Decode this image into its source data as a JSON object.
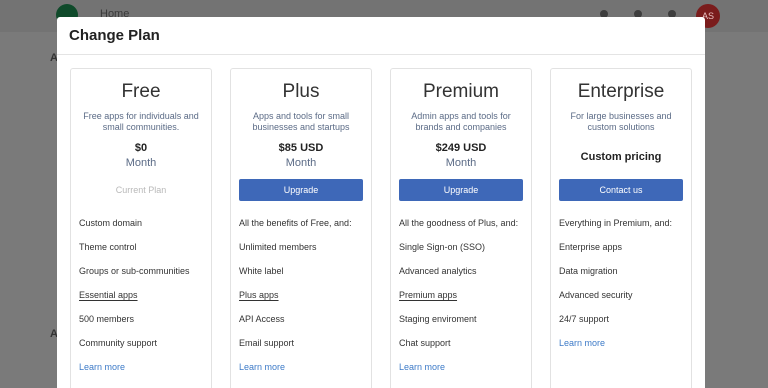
{
  "background": {
    "home_label": "Home",
    "avatar_initials": "AS",
    "letter_a": "A"
  },
  "modal": {
    "title": "Change Plan"
  },
  "plans": [
    {
      "name": "Free",
      "description": "Free apps for individuals and small communities.",
      "price": "$0",
      "period": "Month",
      "action": "Current Plan",
      "features": [
        "Custom domain",
        "Theme control",
        "Groups or sub-communities",
        "Essential apps",
        "500 members",
        "Community support"
      ],
      "learn_more": "Learn more"
    },
    {
      "name": "Plus",
      "description": "Apps and tools for small businesses and startups",
      "price": "$85 USD",
      "period": "Month",
      "action": "Upgrade",
      "features": [
        "All the benefits of Free, and:",
        "Unlimited members",
        "White label",
        "Plus apps",
        "API Access",
        "Email support"
      ],
      "learn_more": "Learn more"
    },
    {
      "name": "Premium",
      "description": "Admin apps and tools for brands and companies",
      "price": "$249 USD",
      "period": "Month",
      "action": "Upgrade",
      "features": [
        "All the goodness of Plus, and:",
        "Single Sign-on (SSO)",
        "Advanced analytics",
        "Premium apps",
        "Staging enviroment",
        "Chat support"
      ],
      "learn_more": "Learn more"
    },
    {
      "name": "Enterprise",
      "description": "For large businesses and custom solutions",
      "custom_pricing": "Custom pricing",
      "action": "Contact us",
      "features": [
        "Everything in Premium, and:",
        "Enterprise apps",
        "Data migration",
        "Advanced security",
        "24/7 support"
      ],
      "learn_more": "Learn more"
    }
  ],
  "colors": {
    "primary_button": "#3e68b8",
    "link": "#3e7bc8",
    "muted_text": "#5b6b86"
  }
}
